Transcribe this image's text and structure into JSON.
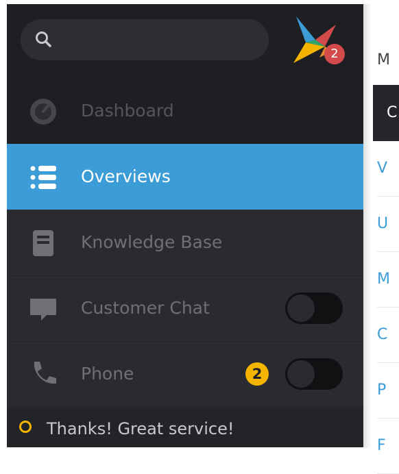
{
  "search": {
    "placeholder": ""
  },
  "logo": {
    "badge": "2"
  },
  "nav": {
    "dashboard": "Dashboard",
    "overviews": "Overviews",
    "knowledge_base": "Knowledge Base",
    "customer_chat": "Customer Chat",
    "phone": "Phone",
    "phone_badge": "2"
  },
  "notification": {
    "text": "Thanks! Great service!"
  },
  "panel": {
    "header": "M",
    "selected": "C",
    "rows": [
      "V",
      "U",
      "M",
      "C",
      "P",
      "F"
    ]
  },
  "colors": {
    "accent": "#3b9cd6",
    "sidebar": "#2a2b30",
    "badge": "#f4b400",
    "logo_badge": "#d34a4a"
  }
}
